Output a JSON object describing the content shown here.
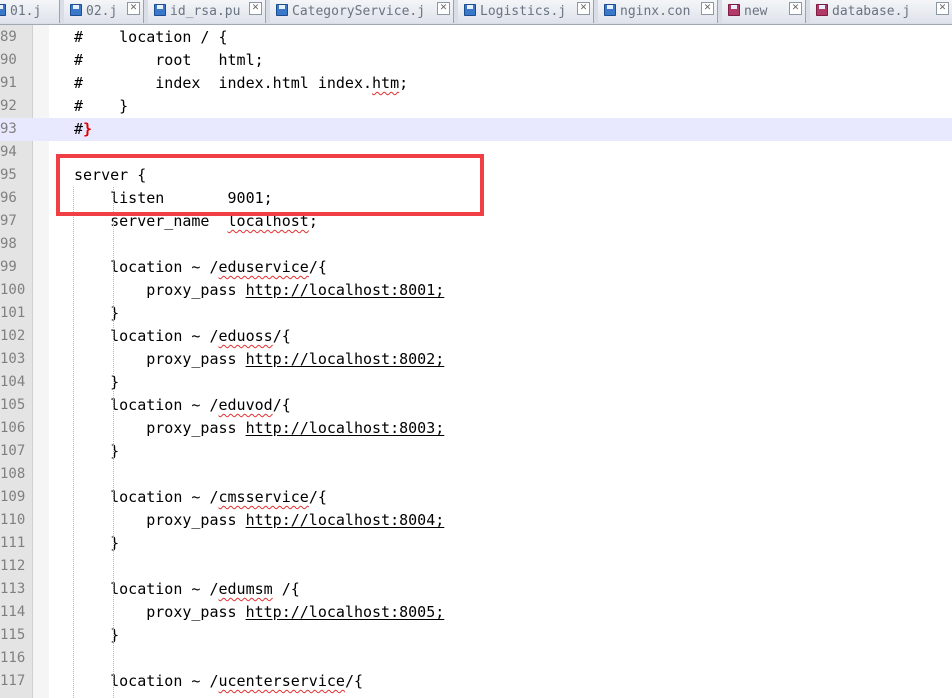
{
  "tabs": [
    {
      "label": "01.j",
      "modified": false
    },
    {
      "label": "02.j",
      "modified": false
    },
    {
      "label": "id_rsa.pu",
      "modified": false
    },
    {
      "label": "CategoryService.j",
      "modified": false
    },
    {
      "label": "Logistics.j",
      "modified": false
    },
    {
      "label": "nginx.con",
      "modified": false
    },
    {
      "label": "new",
      "modified": true
    },
    {
      "label": "database.j",
      "modified": true
    }
  ],
  "icons": {
    "tab_file": "save-disk-icon",
    "tab_close": "close-icon"
  },
  "colors": {
    "highlight": "#f04045",
    "current_line": "#e8e8ff",
    "closing_brace": "#e00000"
  },
  "lines": [
    {
      "num": "89",
      "parts": [
        {
          "t": "#    location / {"
        }
      ]
    },
    {
      "num": "90",
      "parts": [
        {
          "t": "#        root   html;"
        }
      ]
    },
    {
      "num": "91",
      "parts": [
        {
          "t": "#        index  index.html index."
        },
        {
          "t": "htm",
          "s": "squig"
        },
        {
          "t": ";"
        }
      ]
    },
    {
      "num": "92",
      "parts": [
        {
          "t": "#    }"
        }
      ]
    },
    {
      "num": "93",
      "parts": [
        {
          "t": "#"
        },
        {
          "t": "}",
          "s": "brace-red"
        }
      ],
      "current": true
    },
    {
      "num": "94",
      "parts": [
        {
          "t": ""
        }
      ]
    },
    {
      "num": "95",
      "parts": [
        {
          "t": "server {"
        }
      ]
    },
    {
      "num": "96",
      "parts": [
        {
          "t": "    listen       9001;"
        }
      ]
    },
    {
      "num": "97",
      "parts": [
        {
          "t": "    server_name  "
        },
        {
          "t": "localhost",
          "s": "squig"
        },
        {
          "t": ";"
        }
      ]
    },
    {
      "num": "98",
      "parts": [
        {
          "t": ""
        }
      ]
    },
    {
      "num": "99",
      "parts": [
        {
          "t": "    location ~ /"
        },
        {
          "t": "eduservice",
          "s": "squig"
        },
        {
          "t": "/{"
        }
      ]
    },
    {
      "num": "100",
      "parts": [
        {
          "t": "        proxy_pass "
        },
        {
          "t": "http://localhost:8001;",
          "s": "url"
        }
      ]
    },
    {
      "num": "101",
      "parts": [
        {
          "t": "    }"
        }
      ]
    },
    {
      "num": "102",
      "parts": [
        {
          "t": "    location ~ /"
        },
        {
          "t": "eduoss",
          "s": "squig"
        },
        {
          "t": "/{"
        }
      ]
    },
    {
      "num": "103",
      "parts": [
        {
          "t": "        proxy_pass "
        },
        {
          "t": "http://localhost:8002;",
          "s": "url"
        }
      ]
    },
    {
      "num": "104",
      "parts": [
        {
          "t": "    }"
        }
      ]
    },
    {
      "num": "105",
      "parts": [
        {
          "t": "    location ~ /"
        },
        {
          "t": "eduvod",
          "s": "squig"
        },
        {
          "t": "/{"
        }
      ]
    },
    {
      "num": "106",
      "parts": [
        {
          "t": "        proxy_pass "
        },
        {
          "t": "http://localhost:8003;",
          "s": "url"
        }
      ]
    },
    {
      "num": "107",
      "parts": [
        {
          "t": "    }"
        }
      ]
    },
    {
      "num": "108",
      "parts": [
        {
          "t": ""
        }
      ]
    },
    {
      "num": "109",
      "parts": [
        {
          "t": "    location ~ /"
        },
        {
          "t": "cmsservice",
          "s": "squig"
        },
        {
          "t": "/{"
        }
      ]
    },
    {
      "num": "110",
      "parts": [
        {
          "t": "        proxy_pass "
        },
        {
          "t": "http://localhost:8004;",
          "s": "url"
        }
      ]
    },
    {
      "num": "111",
      "parts": [
        {
          "t": "    }"
        }
      ]
    },
    {
      "num": "112",
      "parts": [
        {
          "t": ""
        }
      ]
    },
    {
      "num": "113",
      "parts": [
        {
          "t": "    location ~ /"
        },
        {
          "t": "edumsm",
          "s": "squig"
        },
        {
          "t": " /{"
        }
      ]
    },
    {
      "num": "114",
      "parts": [
        {
          "t": "        proxy_pass "
        },
        {
          "t": "http://localhost:8005;",
          "s": "url"
        }
      ]
    },
    {
      "num": "115",
      "parts": [
        {
          "t": "    }"
        }
      ]
    },
    {
      "num": "116",
      "parts": [
        {
          "t": ""
        }
      ]
    },
    {
      "num": "117",
      "parts": [
        {
          "t": "    location ~ /"
        },
        {
          "t": "ucenterservice",
          "s": "squig"
        },
        {
          "t": "/{"
        }
      ]
    }
  ]
}
